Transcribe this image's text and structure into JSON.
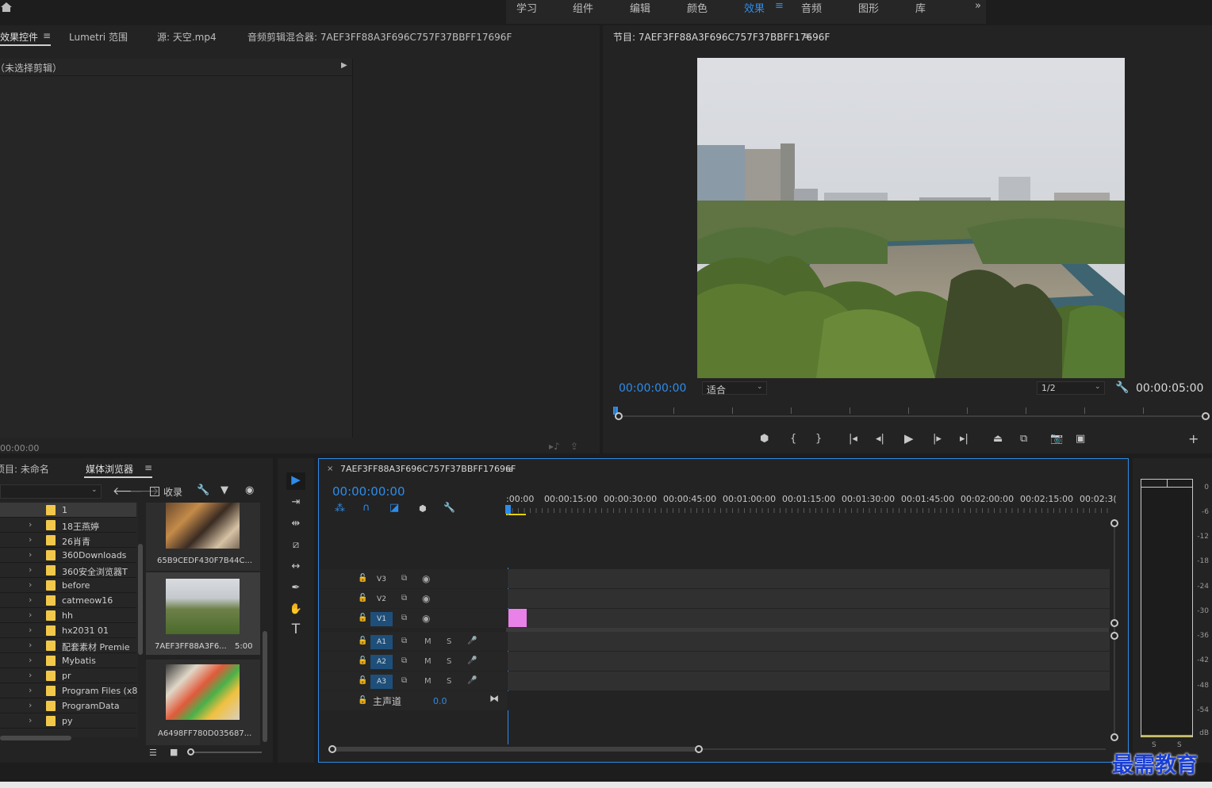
{
  "workspace_tabs": [
    "学习",
    "组件",
    "编辑",
    "颜色",
    "效果",
    "音频",
    "图形",
    "库"
  ],
  "active_workspace": "效果",
  "top_left_panel": {
    "tabs": [
      "效果控件",
      "Lumetri 范围",
      "源: 天空.mp4",
      "音频剪辑混合器: 7AEF3FF88A3F696C757F37BBFF17696F"
    ],
    "no_clip_text": "（未选择剪辑）",
    "timecode": "00:00:00"
  },
  "program_monitor": {
    "title": "节目: 7AEF3FF88A3F696C757F37BBFF17696F",
    "current_time": "00:00:00:00",
    "fit_label": "适合",
    "resolution": "1/2",
    "duration": "00:00:05:00"
  },
  "project_panel": {
    "tabs": [
      "项目: 未命名",
      "媒体浏览器"
    ],
    "favorites_label": "收录",
    "folders": [
      "1",
      "18王燕婷",
      "26肖青",
      "360Downloads",
      "360安全浏览器T",
      "before",
      "catmeow16",
      "hh",
      "hx2031 01",
      "配套素材 Premie",
      "Mybatis",
      "pr",
      "Program Files (x86",
      "ProgramData",
      "py"
    ],
    "thumbnails": [
      {
        "name": "65B9CEDF430F7B44C...",
        "duration": ""
      },
      {
        "name": "7AEF3FF88A3F6...",
        "duration": "5:00"
      },
      {
        "name": "A6498FF780D035687...",
        "duration": ""
      }
    ]
  },
  "timeline": {
    "sequence_name": "7AEF3FF88A3F696C757F37BBFF17696F",
    "current_time": "00:00:00:00",
    "ruler_labels": [
      ":00:00",
      "00:00:15:00",
      "00:00:30:00",
      "00:00:45:00",
      "00:01:00:00",
      "00:01:15:00",
      "00:01:30:00",
      "00:01:45:00",
      "00:02:00:00",
      "00:02:15:00",
      "00:02:3("
    ],
    "video_tracks": [
      "V3",
      "V2",
      "V1"
    ],
    "audio_tracks": [
      "A1",
      "A2",
      "A3"
    ],
    "master_label": "主声道",
    "master_value": "0.0",
    "mute_label": "M",
    "solo_label": "S"
  },
  "audio_meter": {
    "labels": [
      "0",
      "-6",
      "-12",
      "-18",
      "-24",
      "-30",
      "-36",
      "-42",
      "-48",
      "-54",
      "dB"
    ],
    "solo_labels": [
      "S",
      "S"
    ]
  },
  "watermark": "最需教育",
  "colors": {
    "accent_blue": "#2d8ceb",
    "clip_pink": "#e882e8",
    "folder_yellow": "#f2c84b",
    "track_target_blue": "#1e4f7a"
  }
}
